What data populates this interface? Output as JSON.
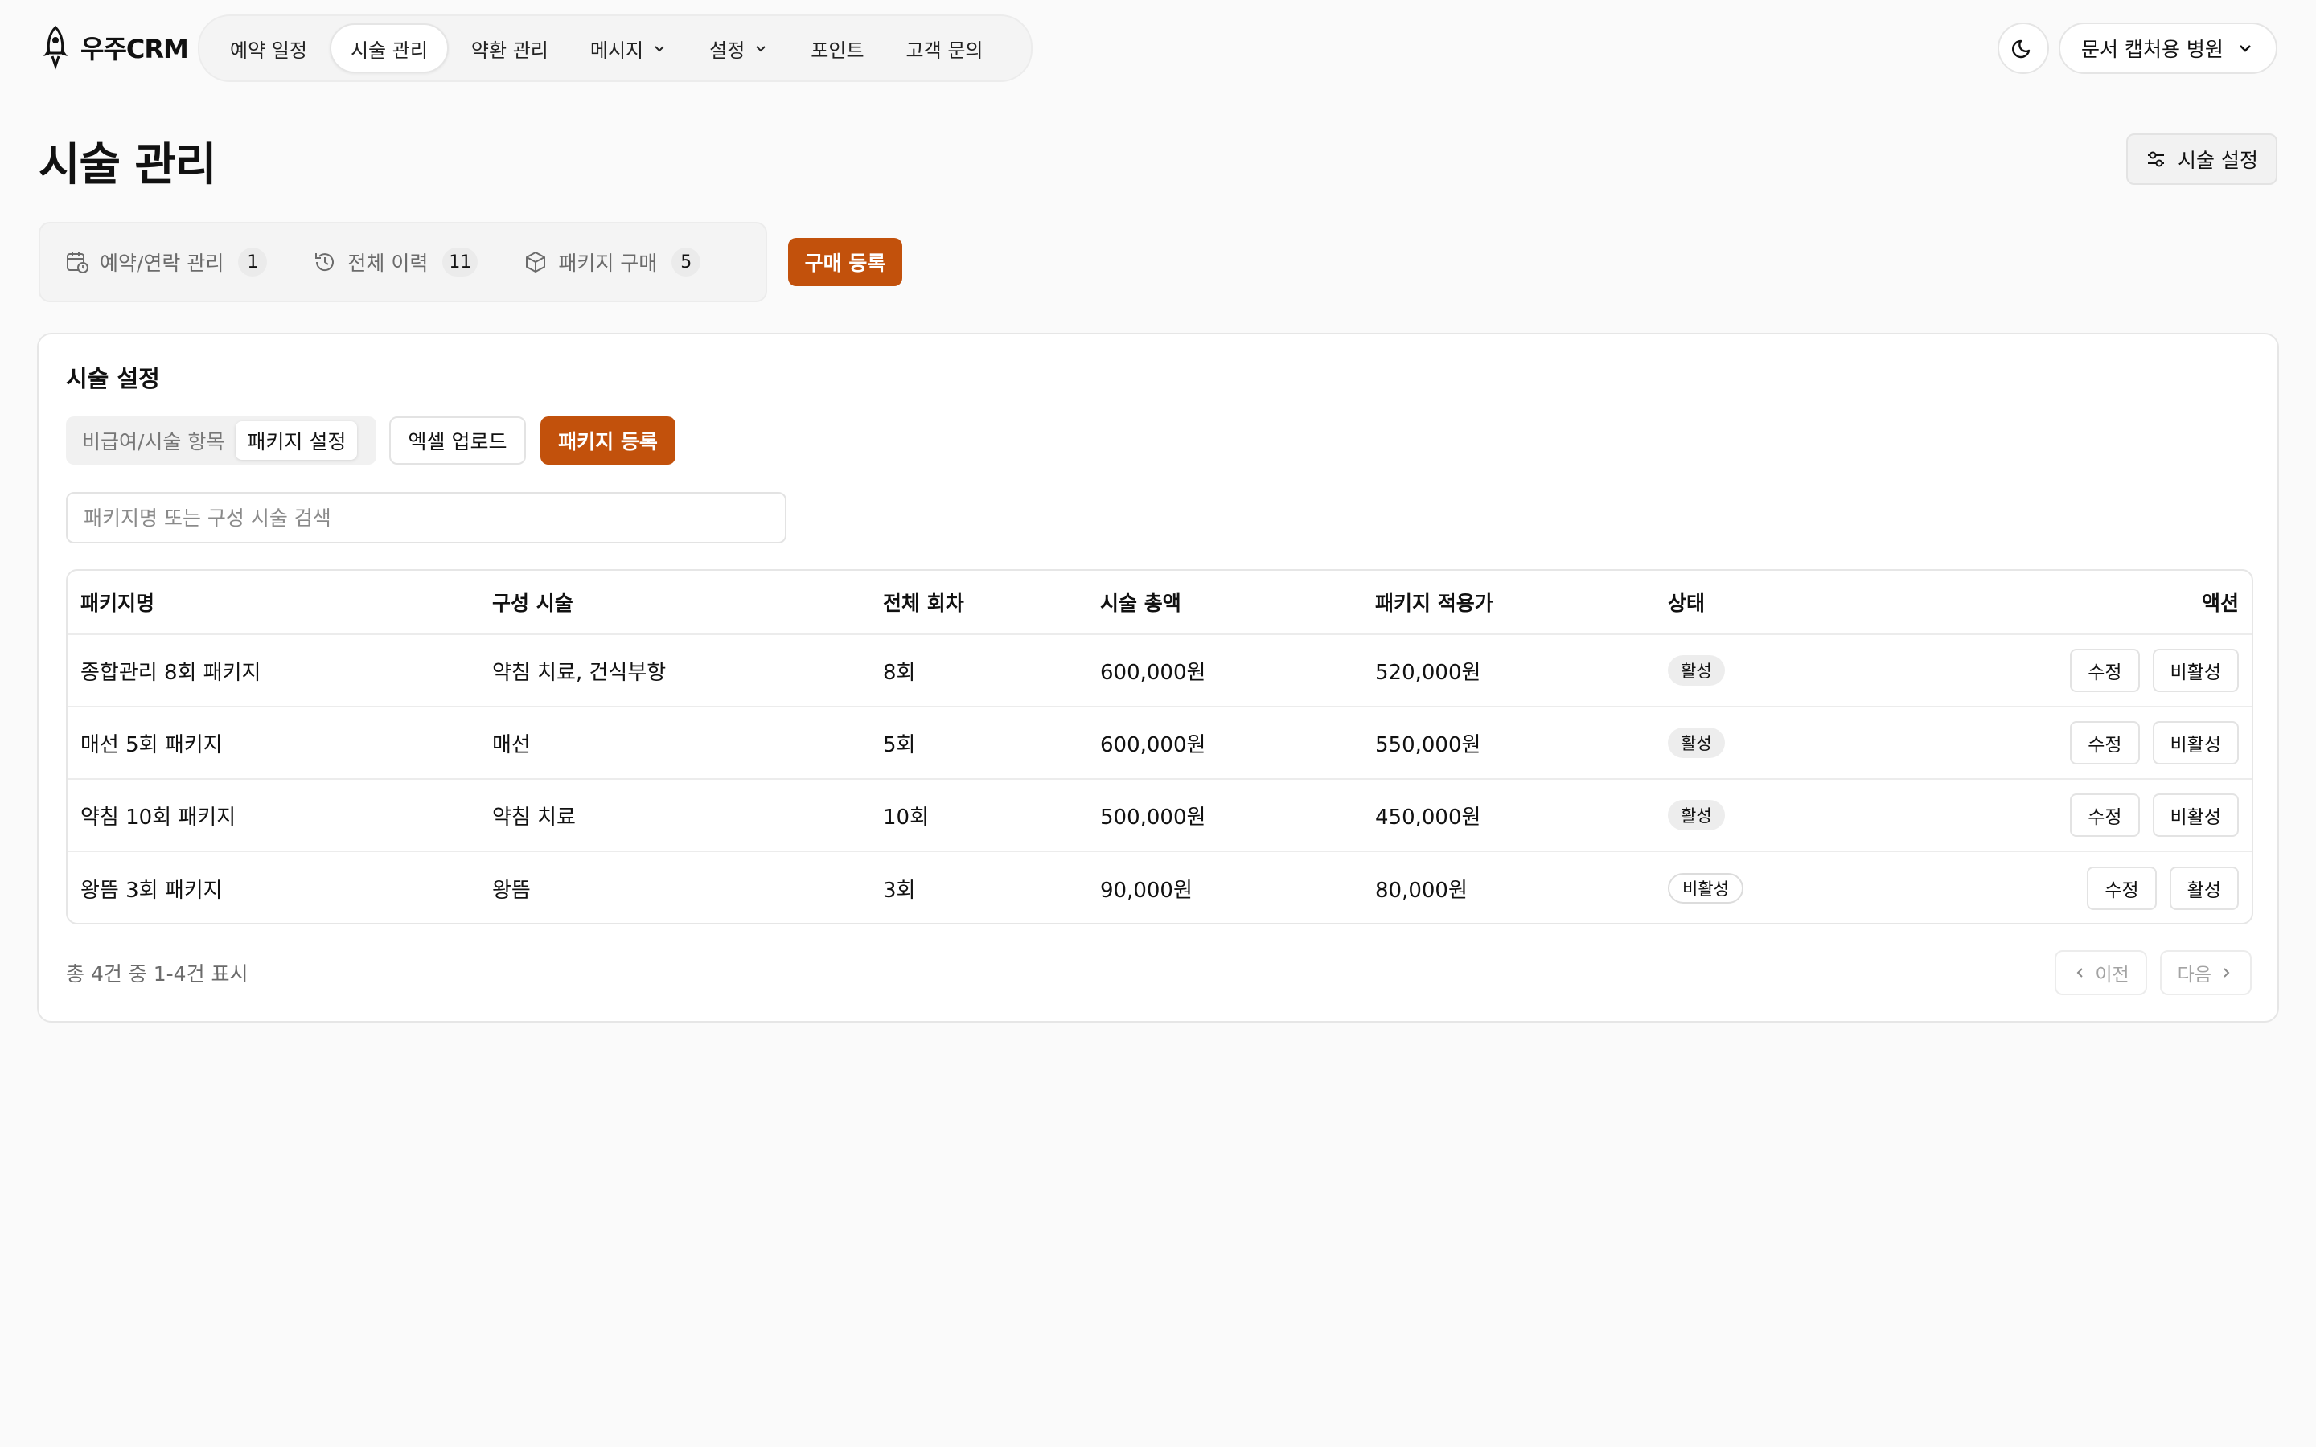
{
  "app": {
    "logo_text": "우주CRM"
  },
  "nav": {
    "items": [
      {
        "label": "예약 일정",
        "dropdown": false,
        "active": false
      },
      {
        "label": "시술 관리",
        "dropdown": false,
        "active": true
      },
      {
        "label": "약환 관리",
        "dropdown": false,
        "active": false
      },
      {
        "label": "메시지",
        "dropdown": true,
        "active": false
      },
      {
        "label": "설정",
        "dropdown": true,
        "active": false
      },
      {
        "label": "포인트",
        "dropdown": false,
        "active": false
      },
      {
        "label": "고객 문의",
        "dropdown": false,
        "active": false
      }
    ]
  },
  "header": {
    "clinic_select": "문서 캡처용 병원",
    "page_title": "시술 관리",
    "settings_button": "시술 설정"
  },
  "subtabs": [
    {
      "label": "예약/연락 관리",
      "count": "1",
      "icon": "calendar-clock-icon"
    },
    {
      "label": "전체 이력",
      "count": "11",
      "icon": "history-icon"
    },
    {
      "label": "패키지 구매",
      "count": "5",
      "icon": "package-icon"
    }
  ],
  "buy_button": "구매 등록",
  "card": {
    "title": "시술 설정",
    "segment": {
      "option_1": "비급여/시술 항목",
      "option_2": "패키지 설정",
      "selected": "패키지 설정"
    },
    "excel_button": "엑셀 업로드",
    "register_button": "패키지 등록",
    "search_placeholder": "패키지명 또는 구성 시술 검색"
  },
  "table": {
    "columns": [
      "패키지명",
      "구성 시술",
      "전체 회차",
      "시술 총액",
      "패키지 적용가",
      "상태",
      "액션"
    ],
    "rows": [
      {
        "name": "종합관리 8회 패키지",
        "treatments": "약침 치료, 건식부항",
        "sessions": "8회",
        "total": "600,000원",
        "price": "520,000원",
        "status": "활성",
        "edit": "수정",
        "toggle": "비활성"
      },
      {
        "name": "매선 5회 패키지",
        "treatments": "매선",
        "sessions": "5회",
        "total": "600,000원",
        "price": "550,000원",
        "status": "활성",
        "edit": "수정",
        "toggle": "비활성"
      },
      {
        "name": "약침 10회 패키지",
        "treatments": "약침 치료",
        "sessions": "10회",
        "total": "500,000원",
        "price": "450,000원",
        "status": "활성",
        "edit": "수정",
        "toggle": "비활성"
      },
      {
        "name": "왕뜸 3회 패키지",
        "treatments": "왕뜸",
        "sessions": "3회",
        "total": "90,000원",
        "price": "80,000원",
        "status": "비활성",
        "edit": "수정",
        "toggle": "활성"
      }
    ]
  },
  "footer": {
    "summary": "총 4건 중 1-4건 표시",
    "prev": "이전",
    "next": "다음"
  },
  "colors": {
    "accent": "#c2510c",
    "background": "#fafafa"
  }
}
